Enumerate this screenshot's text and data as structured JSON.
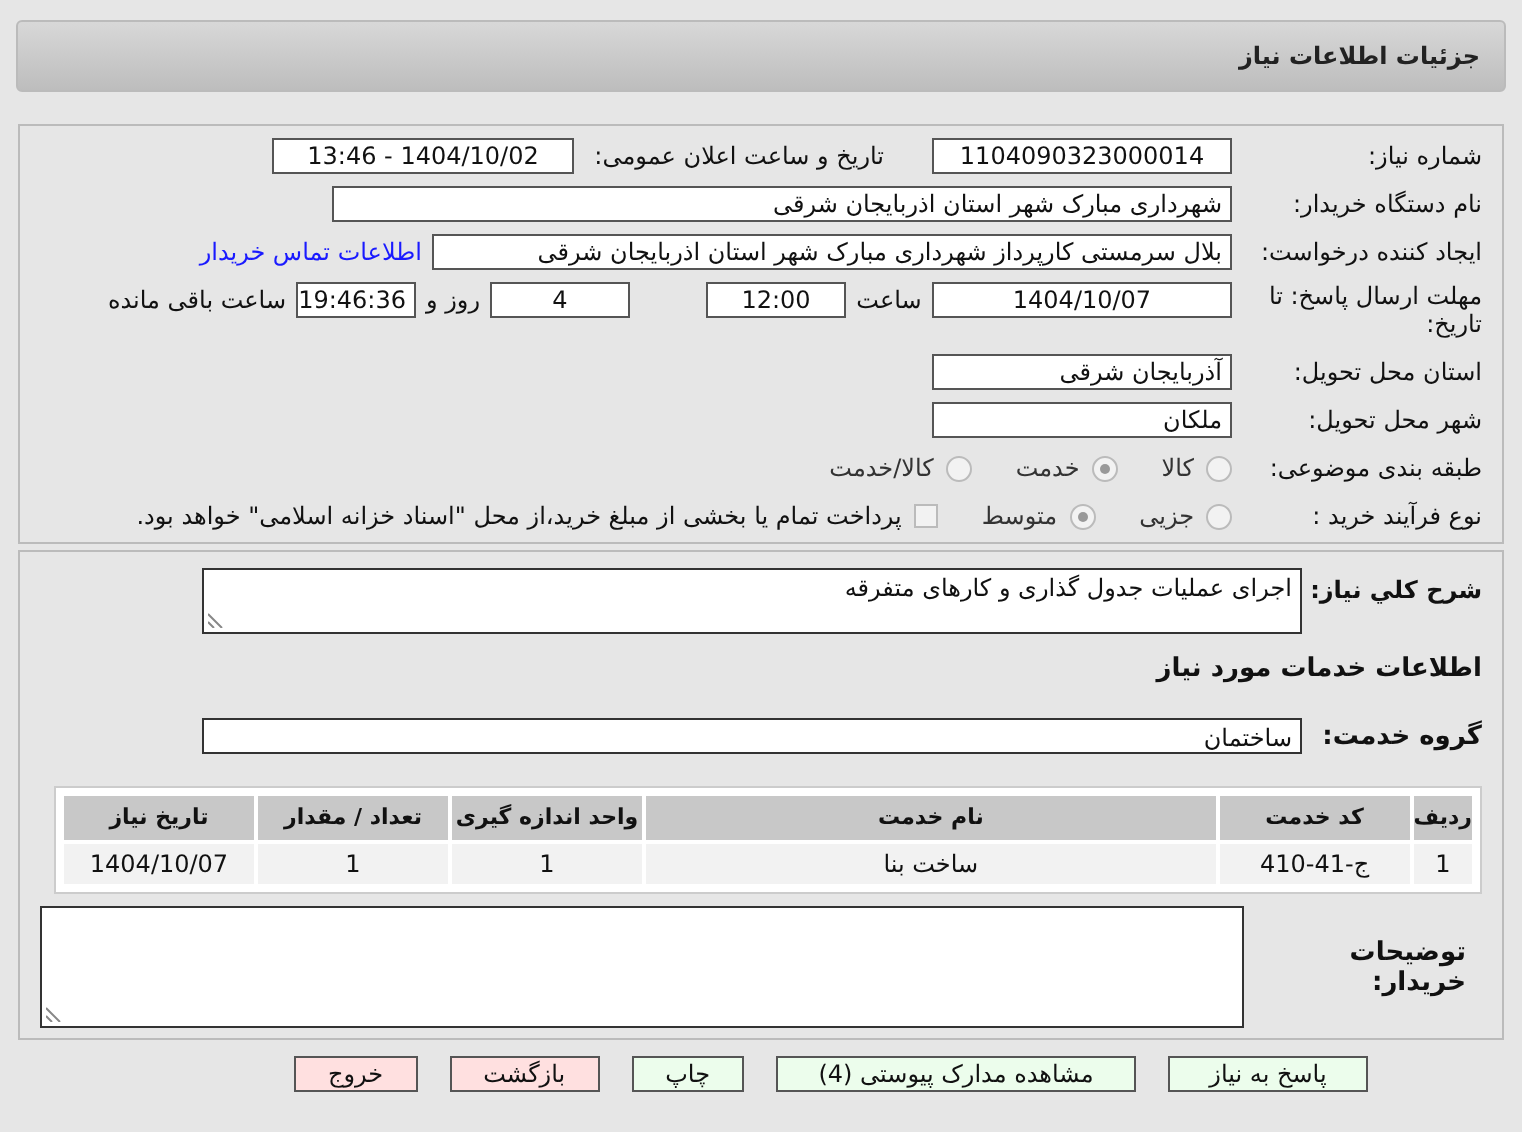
{
  "header": {
    "title": "جزئیات اطلاعات نیاز"
  },
  "need_number": {
    "label": "شماره نیاز:",
    "value": "1104090323000014"
  },
  "announce": {
    "label": "تاریخ و ساعت اعلان عمومی:",
    "value": "1404/10/02 - 13:46"
  },
  "buyer": {
    "label": "نام دستگاه خریدار:",
    "value": "شهرداری مبارک شهر استان اذربایجان شرقی"
  },
  "requester": {
    "label": "ایجاد کننده درخواست:",
    "value": "بلال سرمستی کارپرداز شهرداری مبارک شهر استان اذربایجان شرقی",
    "link": "اطلاعات تماس خریدار"
  },
  "deadline": {
    "label": "مهلت ارسال پاسخ: تا تاریخ:",
    "date": "1404/10/07",
    "time_label": "ساعت",
    "time": "12:00",
    "days": "4",
    "days_label": "روز و",
    "remaining": "19:46:36",
    "remaining_label": "ساعت باقی مانده"
  },
  "province": {
    "label": "استان محل تحویل:",
    "value": "آذربایجان شرقی"
  },
  "city": {
    "label": "شهر محل تحویل:",
    "value": "ملکان"
  },
  "category": {
    "label": "طبقه بندی موضوعی:",
    "options": [
      {
        "label": "کالا",
        "selected": false
      },
      {
        "label": "خدمت",
        "selected": true
      },
      {
        "label": "کالا/خدمت",
        "selected": false
      }
    ]
  },
  "purchase_type": {
    "label": "نوع فرآیند خرید :",
    "options": [
      {
        "label": "جزیی",
        "selected": false
      },
      {
        "label": "متوسط",
        "selected": true
      }
    ],
    "checkbox": {
      "label": "پرداخت تمام یا بخشی از مبلغ خرید،از محل \"اسناد خزانه اسلامی\" خواهد بود.",
      "checked": false
    }
  },
  "description": {
    "label": "شرح کلي نیاز:",
    "value": "اجرای عملیات جدول گذاری و کارهای متفرقه"
  },
  "services_heading": "اطلاعات خدمات مورد نیاز",
  "service_group": {
    "label": "گروه خدمت:",
    "value": "ساختمان"
  },
  "table": {
    "columns": [
      "ردیف",
      "کد خدمت",
      "نام خدمت",
      "واحد اندازه گیری",
      "تعداد / مقدار",
      "تاریخ نیاز"
    ],
    "rows": [
      [
        "1",
        "ج-41-410",
        "ساخت بنا",
        "1",
        "1",
        "1404/10/07"
      ]
    ]
  },
  "buyer_notes": {
    "label": "توضیحات خریدار:"
  },
  "buttons": [
    {
      "label": "پاسخ به نیاز",
      "kind": "normal"
    },
    {
      "label": "مشاهده مدارک پیوستی (4)",
      "kind": "normal"
    },
    {
      "label": "چاپ",
      "kind": "normal"
    },
    {
      "label": "بازگشت",
      "kind": "danger"
    },
    {
      "label": "خروج",
      "kind": "danger"
    }
  ]
}
